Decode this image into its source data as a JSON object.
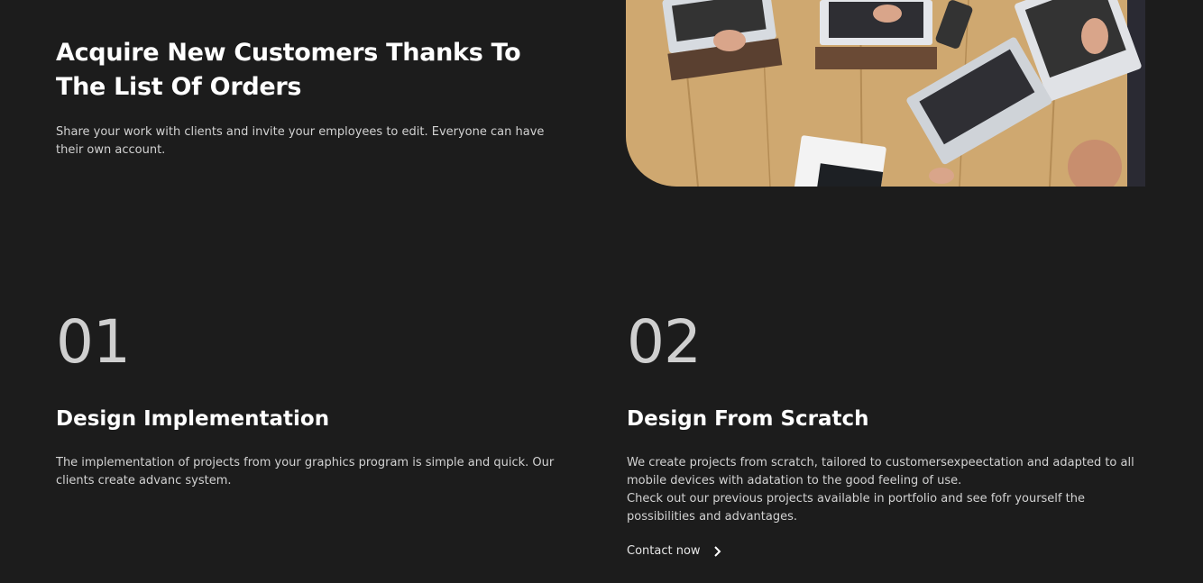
{
  "hero": {
    "title": "Acquire New Customers Thanks To The List Of Orders",
    "text": "Share your work with clients and invite your employees to edit. Everyone can have their own account.",
    "image_icon": "laptops-on-table-photo"
  },
  "features": [
    {
      "number": "01",
      "title": "Design Implementation",
      "text": "The implementation of projects from your graphics program is simple and quick. Our clients create advanc system."
    },
    {
      "number": "02",
      "title": "Design From Scratch",
      "text_1": "We create projects from scratch, tailored to customersexpeectation and adapted to all mobile devices with adatation to the good feeling of use.",
      "text_2": "Check out our previous projects available in portfolio and see fofr yourself the possibilities and advantages.",
      "link_label": "Contact now",
      "link_icon": "chevron-right-icon"
    }
  ],
  "colors": {
    "background": "#1c1c1c",
    "text": "#ffffff",
    "muted_text": "#d2d2d2",
    "number": "#cfcfcf"
  }
}
